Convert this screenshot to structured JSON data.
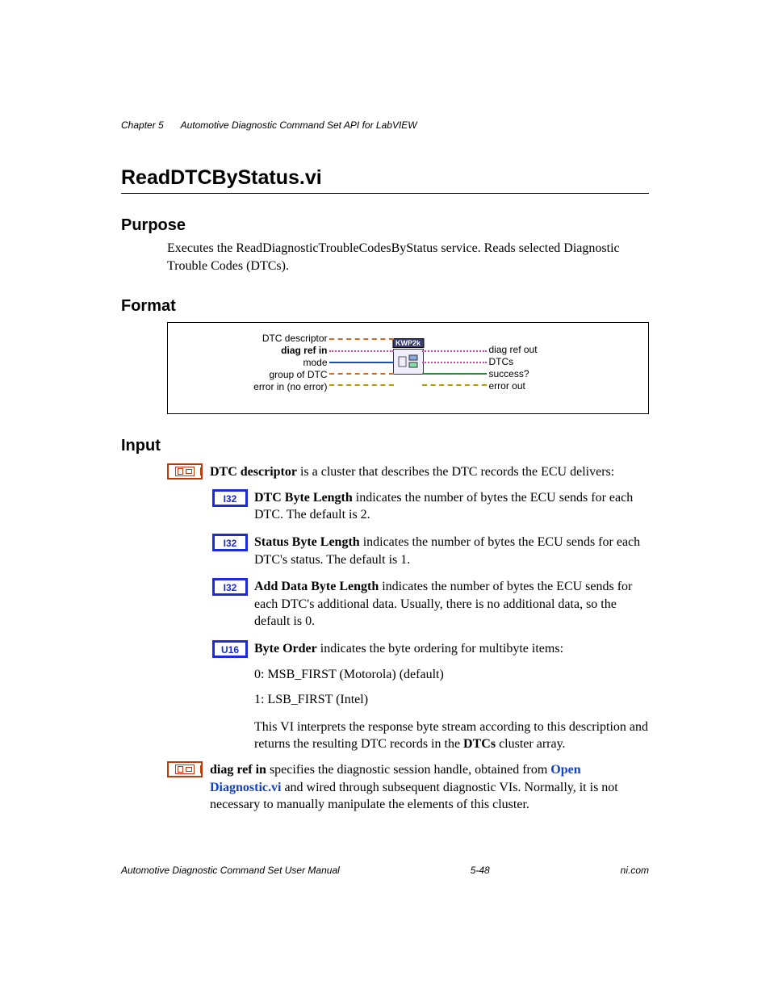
{
  "header": {
    "chapter": "Chapter 5",
    "title": "Automotive Diagnostic Command Set API for LabVIEW"
  },
  "page": {
    "title": "ReadDTCByStatus.vi",
    "purpose": {
      "heading": "Purpose",
      "text": "Executes the ReadDiagnosticTroubleCodesByStatus service. Reads selected Diagnostic Trouble Codes (DTCs)."
    },
    "format": {
      "heading": "Format",
      "inputs": [
        "DTC descriptor",
        "diag ref in",
        "mode",
        "group of DTC",
        "error in (no error)"
      ],
      "outputs": [
        "diag ref out",
        "DTCs",
        "success?",
        "error out"
      ],
      "node_tag": "KWP2k"
    },
    "input": {
      "heading": "Input",
      "dtc_descriptor_label": "DTC descriptor",
      "dtc_descriptor_text": " is a cluster that describes the DTC records the ECU delivers:",
      "dtc_byte_len_label": "DTC Byte Length",
      "dtc_byte_len_text": " indicates the number of bytes the ECU sends for each DTC. The default is 2.",
      "status_byte_len_label": "Status Byte Length",
      "status_byte_len_text": " indicates the number of bytes the ECU sends for each DTC's status. The default is 1.",
      "add_data_len_label": "Add Data Byte Length",
      "add_data_len_text": " indicates the number of bytes the ECU sends for each DTC's additional data. Usually, there is no additional data, so the default is 0.",
      "byte_order_label": "Byte Order",
      "byte_order_text": " indicates the byte ordering for multibyte items:",
      "byte_order_opt0": "0: MSB_FIRST (Motorola) (default)",
      "byte_order_opt1": "1: LSB_FIRST (Intel)",
      "dtc_desc_footer_pre": "This VI interprets the response byte stream according to this description and returns the resulting DTC records in the ",
      "dtc_desc_footer_bold": "DTCs",
      "dtc_desc_footer_post": " cluster array.",
      "diag_ref_label": "diag ref in",
      "diag_ref_text_pre": " specifies the diagnostic session handle, obtained from ",
      "diag_ref_link": "Open Diagnostic.vi",
      "diag_ref_text_post": " and wired through subsequent diagnostic VIs. Normally, it is not necessary to manually manipulate the elements of this cluster.",
      "i32_glyph": "I32",
      "u16_glyph": "U16"
    }
  },
  "footer": {
    "left": "Automotive Diagnostic Command Set User Manual",
    "center": "5-48",
    "right": "ni.com"
  }
}
